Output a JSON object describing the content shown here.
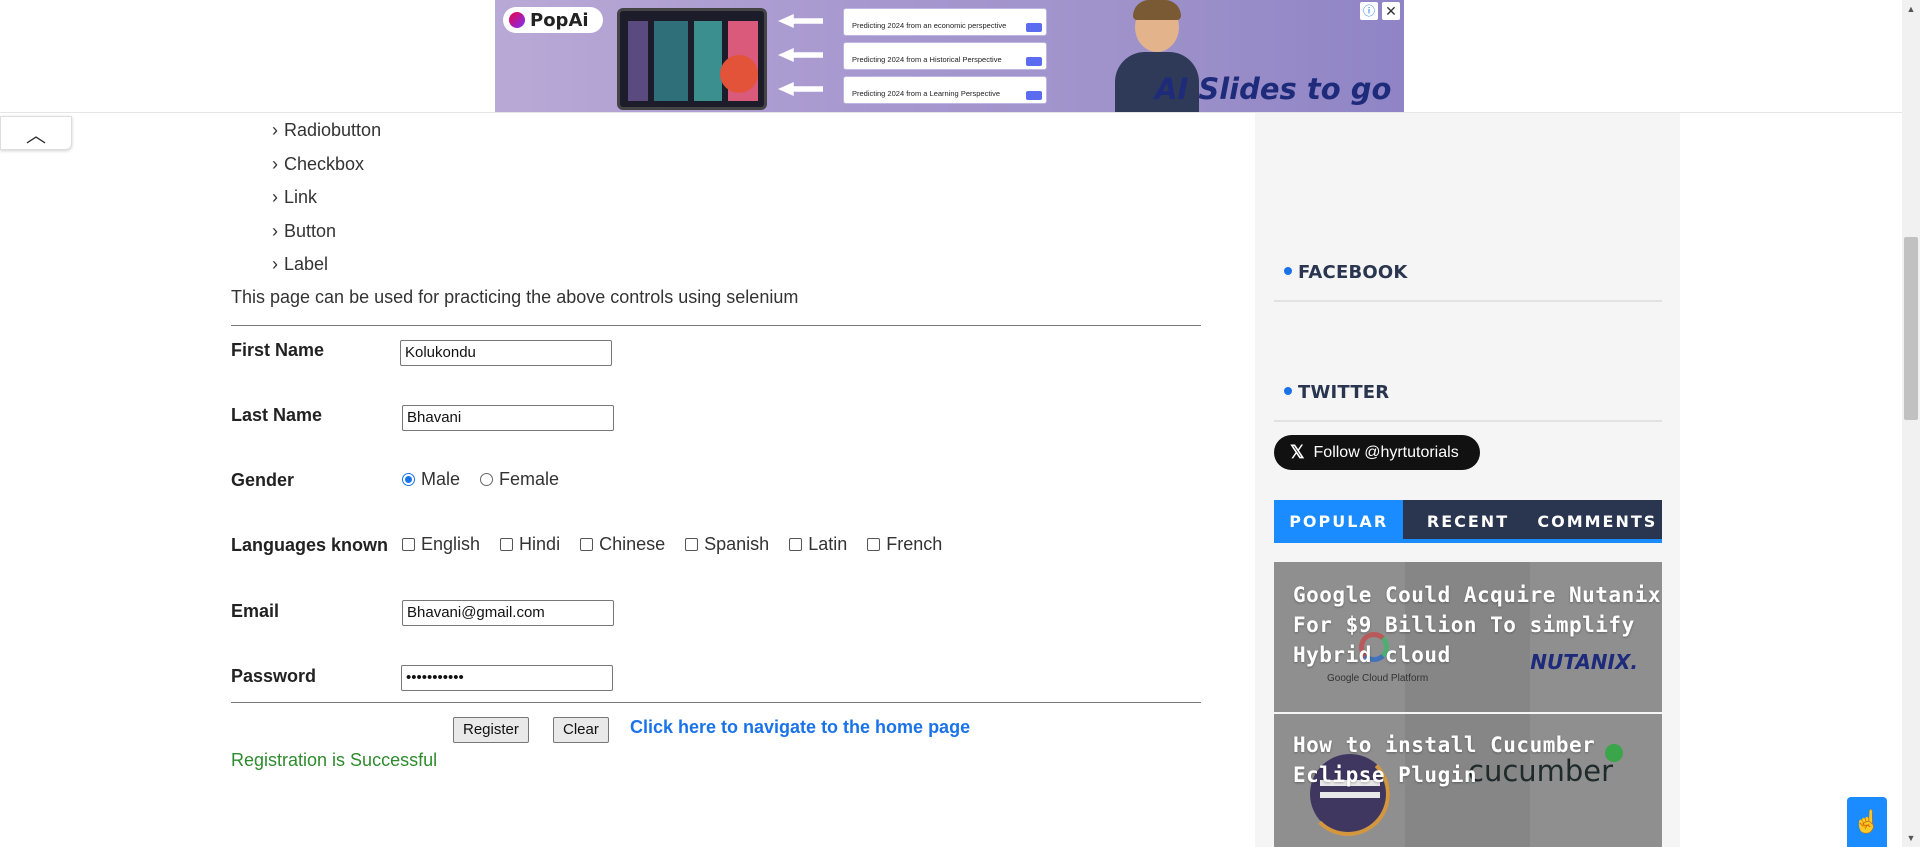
{
  "ad": {
    "brand": "PopAi",
    "cards": [
      "Predicting 2024 from an economic perspective",
      "Predicting 2024 from a Historical Perspective",
      "Predicting 2024 from a Learning Perspective"
    ],
    "tagline": "AI Slides to go",
    "info_icon": "ⓘ",
    "close_icon": "✕"
  },
  "collapse_icon": "︿",
  "controls_list": [
    "Radiobutton",
    "Checkbox",
    "Link",
    "Button",
    "Label"
  ],
  "chevron": "›",
  "intro": "This page can be used for practicing the above controls using selenium",
  "form": {
    "first_name_label": "First Name",
    "first_name_value": "Kolukondu",
    "last_name_label": "Last Name",
    "last_name_value": "Bhavani",
    "gender_label": "Gender",
    "gender_options": [
      "Male",
      "Female"
    ],
    "gender_selected": "Male",
    "languages_label": "Languages known",
    "languages": [
      "English",
      "Hindi",
      "Chinese",
      "Spanish",
      "Latin",
      "French"
    ],
    "email_label": "Email",
    "email_value": "Bhavani@gmail.com",
    "password_label": "Password",
    "password_value": "•••••••••••",
    "register_label": "Register",
    "clear_label": "Clear",
    "home_link": "Click here to navigate to the home page",
    "success_message": "Registration is Successful"
  },
  "sidebar": {
    "facebook_title": "FACEBOOK",
    "twitter_title": "TWITTER",
    "follow_label": "Follow @hyrtutorials",
    "follow_icon": "𝕏",
    "tabs": [
      "POPULAR",
      "RECENT",
      "COMMENTS"
    ],
    "active_tab": "POPULAR",
    "posts": [
      {
        "title_lines": [
          "Google Could Acquire Nutanix",
          "For $9 Billion To simplify",
          "Hybrid cloud"
        ],
        "logo_text": "NUTANIX.",
        "sub_logo": "Google Cloud Platform"
      },
      {
        "title_lines": [
          "How to install Cucumber",
          "Eclipse Plugin"
        ],
        "logo_text": "cucumber"
      }
    ]
  },
  "colors": {
    "accent": "#1a8cff",
    "tabs_bg": "#2a3550",
    "success": "#2e8b2e",
    "link": "#1a73e8"
  },
  "float_button_icon": "hand-pointer-icon"
}
